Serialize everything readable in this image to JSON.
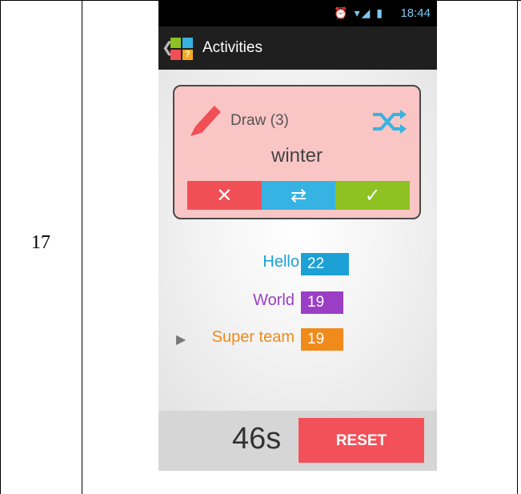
{
  "table": {
    "row_number": "17"
  },
  "status_bar": {
    "time": "18:44",
    "icons": "⏰ ▾◢ ▮"
  },
  "action_bar": {
    "back_icon": "chevron-left-icon",
    "title": "Activities"
  },
  "card": {
    "category": "Draw (3)",
    "word": "winter",
    "buttons": {
      "reject": "✕",
      "swap": "⇄",
      "accept": "✓"
    }
  },
  "teams": [
    {
      "name": "Hello",
      "score": "22",
      "color": "#1ba1d6"
    },
    {
      "name": "World",
      "score": "19",
      "color": "#9a3ec6"
    },
    {
      "name": "Super team",
      "score": "19",
      "color": "#f08a1a",
      "active": true
    }
  ],
  "turn_indicator": "▶",
  "footer": {
    "timer": "46s",
    "reset_label": "RESET"
  },
  "colors": {
    "card_bg": "#f9c6c5",
    "reject": "#f04f56",
    "swap": "#36b3e2",
    "accept": "#8dc222",
    "reset": "#f2515a"
  }
}
